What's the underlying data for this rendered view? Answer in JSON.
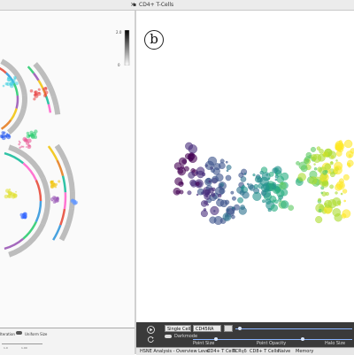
{
  "window": {
    "title": "CD4+ T-Cells",
    "close_glyph": "×"
  },
  "panel_label": "b",
  "colorbar": {
    "max_label": "2.0",
    "min_label": "0"
  },
  "left_legend": {
    "items": [
      "Iteration",
      "Uniform Size"
    ],
    "values": [
      "1.0",
      "1.00"
    ]
  },
  "controls": {
    "mode_select": "Single Cell",
    "marker_select": "CD45RA",
    "darkmode_label": "Darkmode",
    "sliders": [
      "Point Size",
      "Point Opacity",
      "Halo Size"
    ]
  },
  "tabs": [
    "HSNE Analysis - Overview Level",
    "CD4+ T Cells",
    "TCRγδ",
    "CD8+ T Cells",
    "Naive",
    "Memory"
  ],
  "colors": {
    "viridis": [
      "#440154",
      "#472d7b",
      "#3b528b",
      "#2c728e",
      "#21918c",
      "#28ae80",
      "#5ec962",
      "#addc30",
      "#fde725"
    ],
    "ring_segments": [
      "#e74c3c",
      "#3498db",
      "#2ecc71",
      "#9b59b6",
      "#f1c40f",
      "#e67e22",
      "#1abc9c",
      "#ff66cc"
    ]
  }
}
